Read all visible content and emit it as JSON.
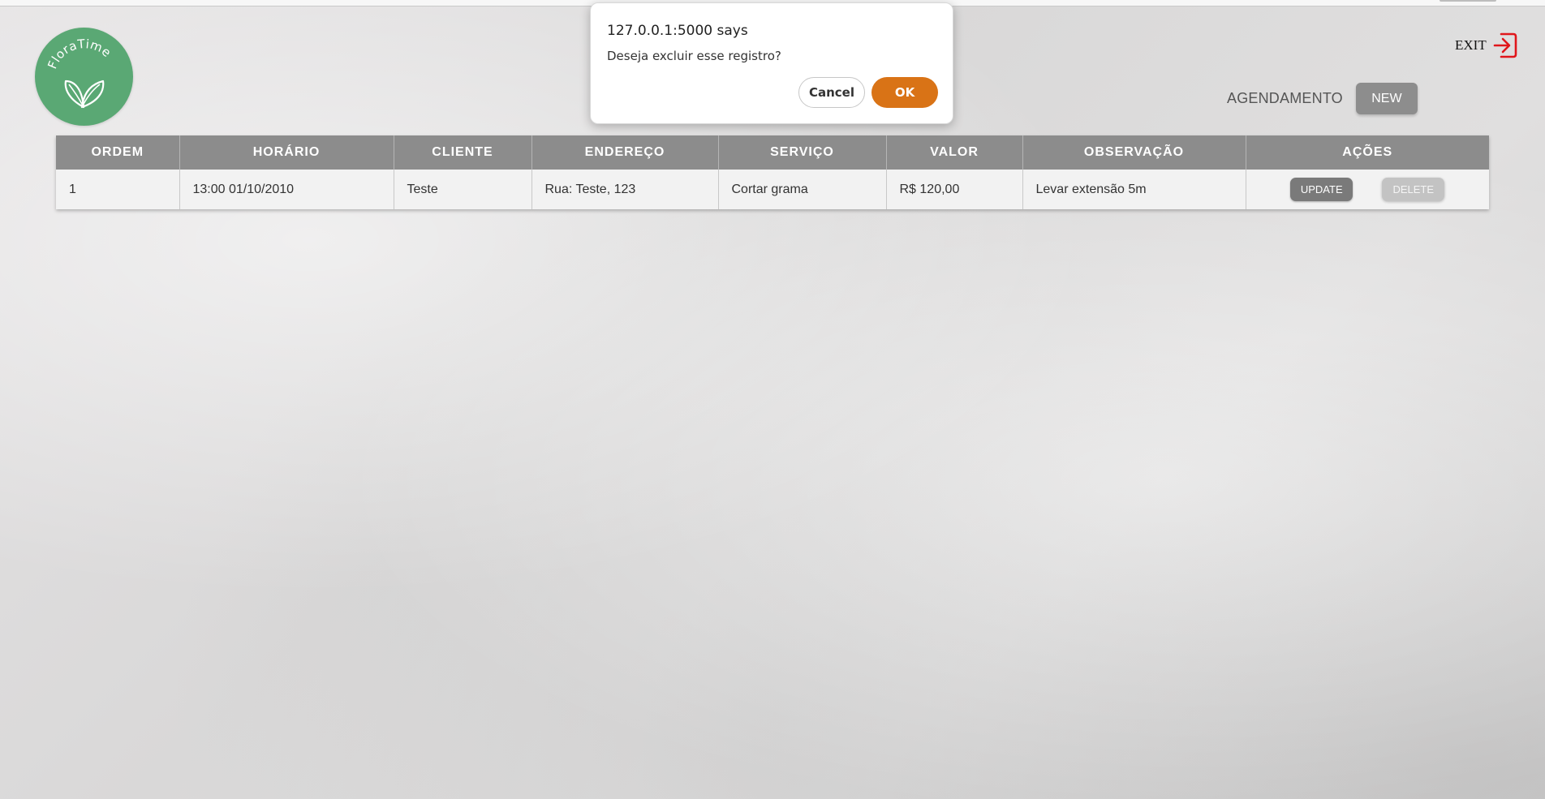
{
  "logo": {
    "text": "FloraTime"
  },
  "header": {
    "exit_label": "EXIT",
    "section_title": "AGENDAMENTO",
    "new_label": "NEW"
  },
  "table": {
    "headers": [
      "ORDEM",
      "HORÁRIO",
      "CLIENTE",
      "ENDEREÇO",
      "SERVIÇO",
      "VALOR",
      "OBSERVAÇÃO",
      "AÇÕES"
    ],
    "rows": [
      {
        "ordem": "1",
        "horario": "13:00 01/10/2010",
        "cliente": "Teste",
        "endereco": "Rua: Teste, 123",
        "servico": "Cortar grama",
        "valor": "R$ 120,00",
        "observacao": "Levar extensão 5m",
        "update_label": "UPDATE",
        "delete_label": "DELETE"
      }
    ]
  },
  "dialog": {
    "title": "127.0.0.1:5000 says",
    "message": "Deseja excluir esse registro?",
    "cancel_label": "Cancel",
    "ok_label": "OK"
  },
  "colors": {
    "logo_green": "#5aa874",
    "header_gray": "#8c8c8c",
    "ok_orange": "#d97316",
    "exit_red": "#e0161b"
  }
}
